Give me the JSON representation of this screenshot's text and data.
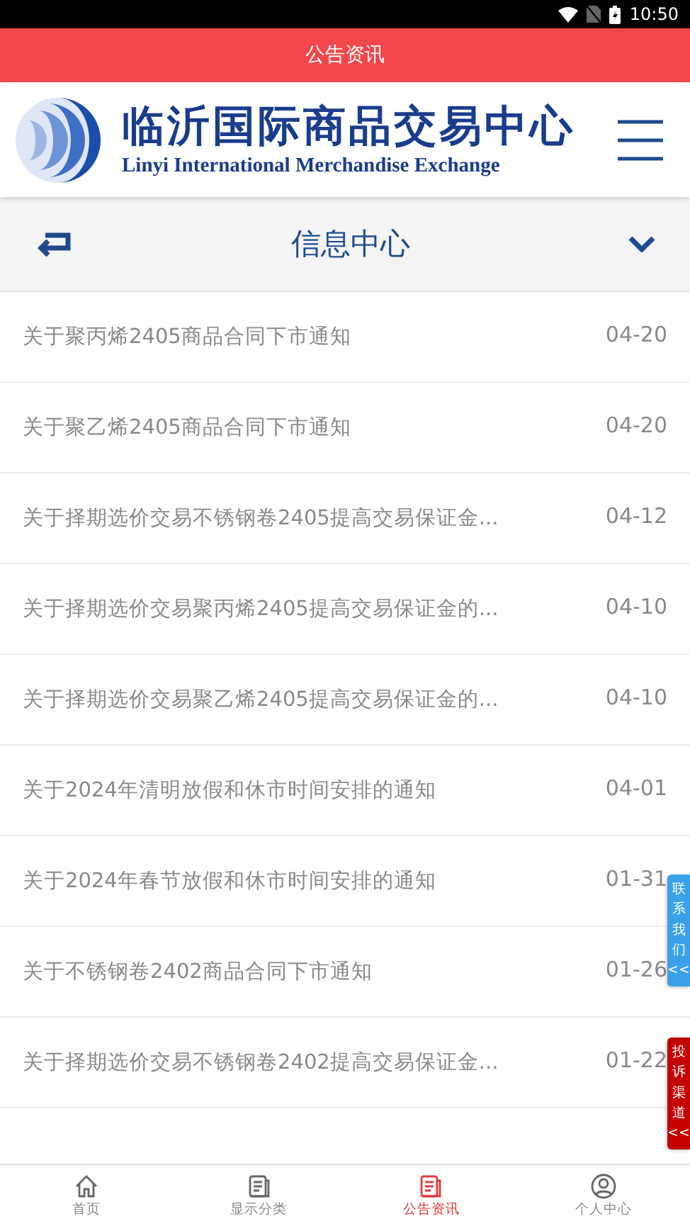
{
  "status_bar": {
    "time": "10:50"
  },
  "title_bar": {
    "title": "公告资讯"
  },
  "brand": {
    "name": "临沂国际商品交易中心",
    "subtitle": "Linyi International Merchandise Exchange"
  },
  "section": {
    "title": "信息中心"
  },
  "notices": [
    {
      "title": "关于聚丙烯2405商品合同下市通知",
      "date": "04-20"
    },
    {
      "title": "关于聚乙烯2405商品合同下市通知",
      "date": "04-20"
    },
    {
      "title": "关于择期选价交易不锈钢卷2405提高交易保证金...",
      "date": "04-12"
    },
    {
      "title": "关于择期选价交易聚丙烯2405提高交易保证金的...",
      "date": "04-10"
    },
    {
      "title": "关于择期选价交易聚乙烯2405提高交易保证金的...",
      "date": "04-10"
    },
    {
      "title": "关于2024年清明放假和休市时间安排的通知",
      "date": "04-01"
    },
    {
      "title": "关于2024年春节放假和休市时间安排的通知",
      "date": "01-31"
    },
    {
      "title": "关于不锈钢卷2402商品合同下市通知",
      "date": "01-26"
    },
    {
      "title": "关于择期选价交易不锈钢卷2402提高交易保证金...",
      "date": "01-22"
    }
  ],
  "side_tabs": [
    {
      "label": "联系我们",
      "arrow": "<<",
      "color": "#3aa0e8"
    },
    {
      "label": "投诉渠道",
      "arrow": "<<",
      "color": "#c40000"
    }
  ],
  "bottom_nav": [
    {
      "label": "首页",
      "kind": "home",
      "selected": false
    },
    {
      "label": "显示分类",
      "kind": "doc",
      "selected": false
    },
    {
      "label": "公告资讯",
      "kind": "doc",
      "selected": true
    },
    {
      "label": "个人中心",
      "kind": "user",
      "selected": false
    }
  ]
}
